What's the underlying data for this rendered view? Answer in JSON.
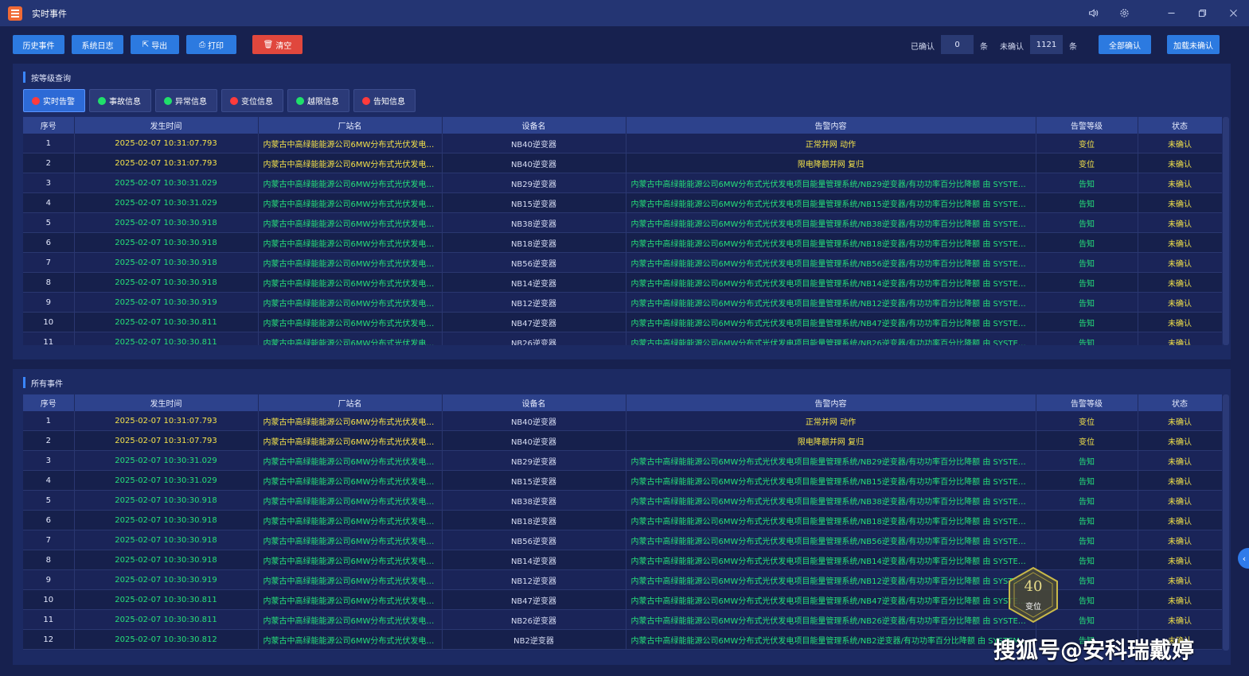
{
  "app": {
    "title": "实时事件"
  },
  "window_controls": [
    "volume-icon",
    "gear-icon",
    "minimize-icon",
    "restore-icon",
    "close-icon"
  ],
  "toolbar": {
    "history_label": "历史事件",
    "syslog_label": "系统日志",
    "export_label": "导出",
    "print_label": "打印",
    "clear_label": "清空",
    "confirmed_label": "已确认",
    "confirmed_value": "0",
    "unit1": "条",
    "unconfirmed_label": "未确认",
    "unconfirmed_value": "1121",
    "unit2": "条",
    "confirm_all_label": "全部确认",
    "load_unconfirmed_label": "加载未确认"
  },
  "level_panel": {
    "title": "按等级查询",
    "filters": [
      {
        "label": "实时告警",
        "dot": "red"
      },
      {
        "label": "事故信息",
        "dot": "green"
      },
      {
        "label": "异常信息",
        "dot": "green"
      },
      {
        "label": "变位信息",
        "dot": "red"
      },
      {
        "label": "越限信息",
        "dot": "green"
      },
      {
        "label": "告知信息",
        "dot": "red"
      }
    ]
  },
  "all_panel": {
    "title": "所有事件"
  },
  "table": {
    "headers": [
      "序号",
      "发生时间",
      "厂站名",
      "设备名",
      "告警内容",
      "告警等级",
      "状态"
    ],
    "plant": "内蒙古中高绿能能源公司6MW分布式光伏发电项...",
    "rows": [
      {
        "seq": "1",
        "time": "2025-02-07 10:31:07.793",
        "device": "NB40逆变器",
        "content": "正常并网 动作",
        "level": "变位",
        "state": "未确认",
        "tone": "y"
      },
      {
        "seq": "2",
        "time": "2025-02-07 10:31:07.793",
        "device": "NB40逆变器",
        "content": "限电降额并网 复归",
        "level": "变位",
        "state": "未确认",
        "tone": "y"
      },
      {
        "seq": "3",
        "time": "2025-02-07 10:30:31.029",
        "device": "NB29逆变器",
        "content": "内蒙古中高绿能能源公司6MW分布式光伏发电项目能量管理系统/NB29逆变器/有功功率百分比降额 由 SYSTEM ...",
        "level": "告知",
        "state": "未确认",
        "tone": "g"
      },
      {
        "seq": "4",
        "time": "2025-02-07 10:30:31.029",
        "device": "NB15逆变器",
        "content": "内蒙古中高绿能能源公司6MW分布式光伏发电项目能量管理系统/NB15逆变器/有功功率百分比降额 由 SYSTEM ...",
        "level": "告知",
        "state": "未确认",
        "tone": "g"
      },
      {
        "seq": "5",
        "time": "2025-02-07 10:30:30.918",
        "device": "NB38逆变器",
        "content": "内蒙古中高绿能能源公司6MW分布式光伏发电项目能量管理系统/NB38逆变器/有功功率百分比降额 由 SYSTEM ...",
        "level": "告知",
        "state": "未确认",
        "tone": "g"
      },
      {
        "seq": "6",
        "time": "2025-02-07 10:30:30.918",
        "device": "NB18逆变器",
        "content": "内蒙古中高绿能能源公司6MW分布式光伏发电项目能量管理系统/NB18逆变器/有功功率百分比降额 由 SYSTEM ...",
        "level": "告知",
        "state": "未确认",
        "tone": "g"
      },
      {
        "seq": "7",
        "time": "2025-02-07 10:30:30.918",
        "device": "NB56逆变器",
        "content": "内蒙古中高绿能能源公司6MW分布式光伏发电项目能量管理系统/NB56逆变器/有功功率百分比降额 由 SYSTEM ...",
        "level": "告知",
        "state": "未确认",
        "tone": "g"
      },
      {
        "seq": "8",
        "time": "2025-02-07 10:30:30.918",
        "device": "NB14逆变器",
        "content": "内蒙古中高绿能能源公司6MW分布式光伏发电项目能量管理系统/NB14逆变器/有功功率百分比降额 由 SYSTEM ...",
        "level": "告知",
        "state": "未确认",
        "tone": "g"
      },
      {
        "seq": "9",
        "time": "2025-02-07 10:30:30.919",
        "device": "NB12逆变器",
        "content": "内蒙古中高绿能能源公司6MW分布式光伏发电项目能量管理系统/NB12逆变器/有功功率百分比降额 由 SYSTEM ...",
        "level": "告知",
        "state": "未确认",
        "tone": "g"
      },
      {
        "seq": "10",
        "time": "2025-02-07 10:30:30.811",
        "device": "NB47逆变器",
        "content": "内蒙古中高绿能能源公司6MW分布式光伏发电项目能量管理系统/NB47逆变器/有功功率百分比降额 由 SYSTEM ...",
        "level": "告知",
        "state": "未确认",
        "tone": "g"
      },
      {
        "seq": "11",
        "time": "2025-02-07 10:30:30.811",
        "device": "NB26逆变器",
        "content": "内蒙古中高绿能能源公司6MW分布式光伏发电项目能量管理系统/NB26逆变器/有功功率百分比降额 由 SYSTEM ...",
        "level": "告知",
        "state": "未确认",
        "tone": "g"
      },
      {
        "seq": "12",
        "time": "2025-02-07 10:30:30.812",
        "device": "NB2逆变器",
        "content": "内蒙古中高绿能能源公司6MW分布式光伏发电项目能量管理系统/NB2逆变器/有功功率百分比降额 由 SYSTEM ...",
        "level": "告知",
        "state": "未确认",
        "tone": "g"
      }
    ]
  },
  "float_badge": {
    "count": "40",
    "label": "变位"
  },
  "watermark": "搜狐号@安科瑞戴婷",
  "colors": {
    "yellow_text": "#f3e24a",
    "green_text": "#26e07a",
    "accent": "#2c7ae0",
    "danger": "#e0473d"
  }
}
